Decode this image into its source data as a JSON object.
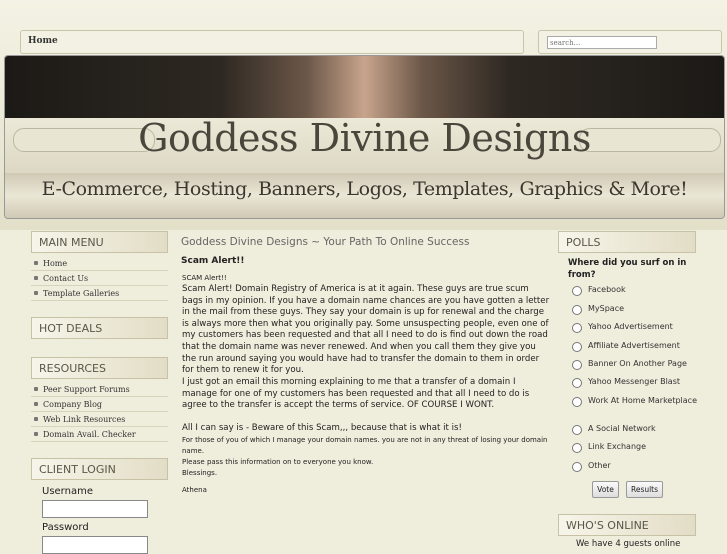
{
  "nav": {
    "home": "Home"
  },
  "search": {
    "placeholder": "search..."
  },
  "banner": {
    "title": "Goddess Divine Designs",
    "tagline": "E-Commerce, Hosting, Banners, Logos, Templates, Graphics & More!"
  },
  "left": {
    "main_menu": {
      "title": "MAIN MENU",
      "items": [
        "Home",
        "Contact Us",
        "Template Galleries"
      ]
    },
    "hot_deals": {
      "title": "HOT DEALS"
    },
    "resources": {
      "title": "RESOURCES",
      "items": [
        "Peer Support Forums",
        "Company Blog",
        "Web Link Resources",
        "Domain Avail. Checker"
      ]
    },
    "client_login": {
      "title": "CLIENT LOGIN",
      "username_label": "Username",
      "password_label": "Password"
    }
  },
  "main": {
    "title": "Goddess Divine Designs ~ Your Path To Online Success",
    "subtitle": "Scam Alert!!",
    "alert_small": "SCAM Alert!!",
    "para1": "Scam Alert! Domain Registry of America is at it again. These guys are true scum bags in my opinion. If you have a domain name chances are you have gotten a letter in the mail from these guys. They say your domain is up for renewal and the charge is always more then what you originally pay. Some unsuspecting people, even one of my customers has been requested and that all I need to do is find out down the road that the domain name was never renewed. And when you call them they give you the run around saying you would have had to transfer the domain to them in order for them to renew it for you.",
    "para2": "I just got an email this morning explaining to me that a transfer of a domain I manage for one of my customers has been requested and that all I need to do is agree to the transfer is accept the terms of service. OF COURSE I WONT.",
    "para3": "All I can say is - Beware of this Scam,,, because that is what it is!",
    "para4": "For those of you of which I manage your domain names. you are not in any threat of losing your domain name.",
    "para5": "Please pass this information on to everyone you know.",
    "para6": "Blessings.",
    "para7": "Athena"
  },
  "right": {
    "polls": {
      "title": "POLLS",
      "question": "Where did you surf on in from?",
      "options": [
        "Facebook",
        "MySpace",
        "Yahoo Advertisement",
        "Affiliate Advertisement",
        "Banner On Another Page",
        "Yahoo Messenger Blast",
        "Work At Home Marketplace",
        "A Social Network",
        "Link Exchange",
        "Other"
      ],
      "vote_label": "Vote",
      "results_label": "Results"
    },
    "whos_online": {
      "title": "WHO'S ONLINE",
      "text": "We have 4 guests online"
    }
  }
}
